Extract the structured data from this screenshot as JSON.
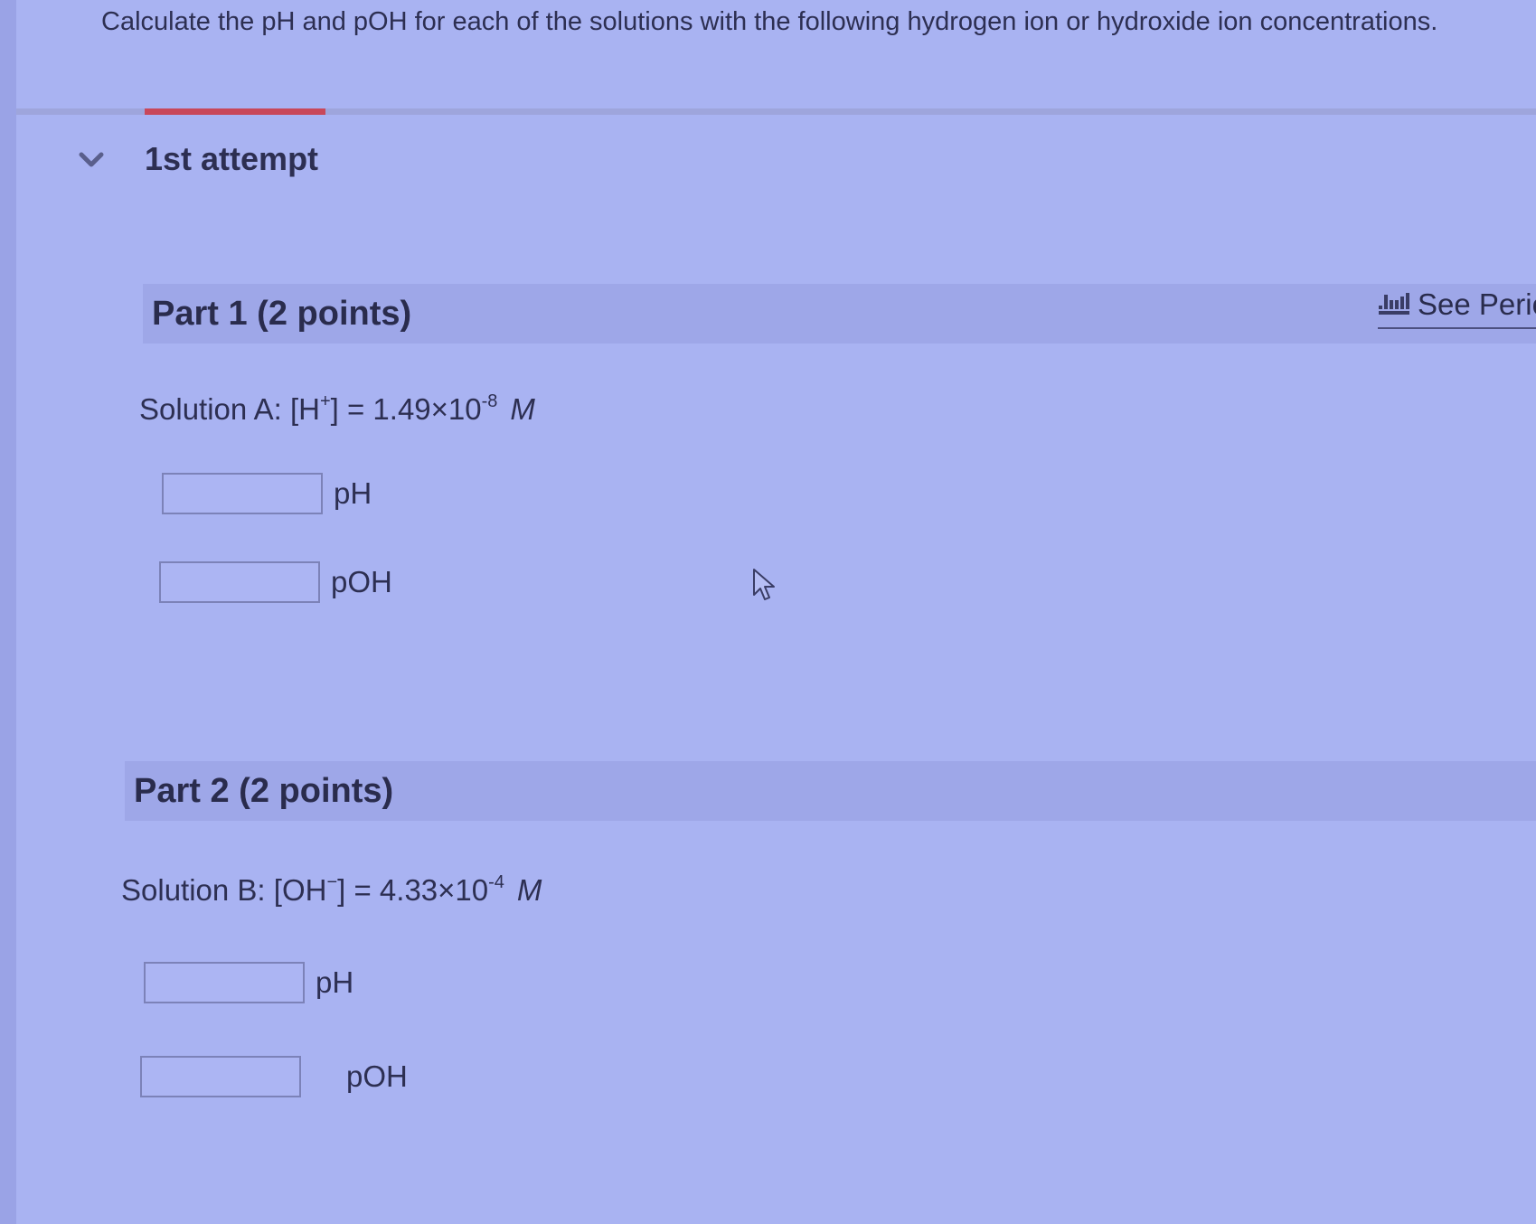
{
  "question": {
    "text": "Calculate the pH and pOH for each of the solutions with the following hydrogen ion or hydroxide ion concentrations."
  },
  "attempt": {
    "title": "1st attempt",
    "toggle_icon": "chevron-down-icon"
  },
  "periodic_table_link": {
    "label": "See Perio",
    "icon": "periodic-table-icon"
  },
  "parts": [
    {
      "title": "Part 1   (2 points)",
      "solution": {
        "prefix": "Solution A:  [H",
        "ion_charge": "+",
        "middle": "] = 1.49×10",
        "exponent": "-8",
        "unit": "M"
      },
      "answers": [
        {
          "label": "pH",
          "value": ""
        },
        {
          "label": "pOH",
          "value": ""
        }
      ]
    },
    {
      "title": "Part 2   (2 points)",
      "solution": {
        "prefix": "Solution B: [OH",
        "ion_charge": "−",
        "middle": "] = 4.33×10",
        "exponent": "-4",
        "unit": "M"
      },
      "answers": [
        {
          "label": "pH",
          "value": ""
        },
        {
          "label": "pOH",
          "value": ""
        }
      ]
    }
  ],
  "colors": {
    "background": "#a9b3f2",
    "part_header": "#9ea7e8",
    "accent": "#c8475a",
    "text": "#2d2f52"
  }
}
